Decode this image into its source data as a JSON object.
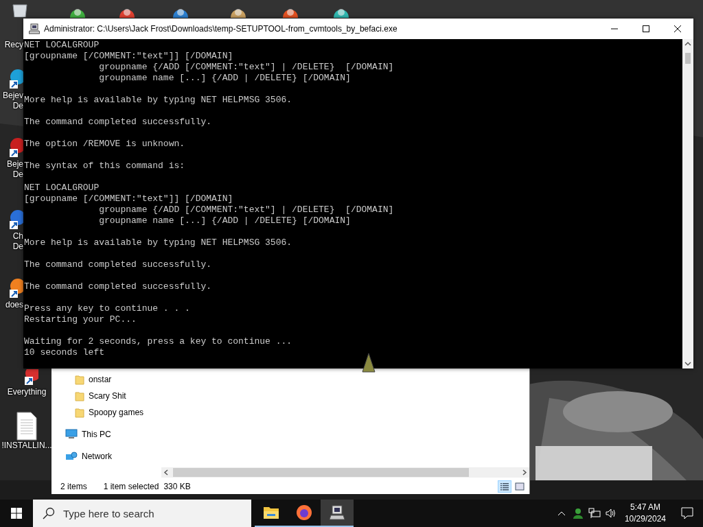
{
  "desktop_icons": [
    {
      "kind": "recycle-bin",
      "lines": [
        "Recy"
      ]
    },
    {
      "kind": "shortcut",
      "lines": [
        "Bejev",
        "De"
      ]
    },
    {
      "kind": "shortcut",
      "lines": [
        "Beje",
        "De"
      ]
    },
    {
      "kind": "shortcut",
      "lines": [
        "Ch",
        "De"
      ]
    },
    {
      "kind": "shortcut",
      "lines": [
        "does"
      ]
    },
    {
      "kind": "shortcut",
      "lines": [
        "Everything"
      ]
    },
    {
      "kind": "document",
      "lines": [
        "!INSTALLIN..."
      ]
    }
  ],
  "console": {
    "title": "Administrator: C:\\Users\\Jack Frost\\Downloads\\temp-SETUPTOOL-from_cvmtools_by_befaci.exe",
    "blocks": [
      [
        "NET LOCALGROUP",
        "[groupname [/COMMENT:\"text\"]] [/DOMAIN]",
        "              groupname {/ADD [/COMMENT:\"text\"] | /DELETE}  [/DOMAIN]",
        "              groupname name [...] {/ADD | /DELETE} [/DOMAIN]"
      ],
      [
        "More help is available by typing NET HELPMSG 3506."
      ],
      [
        "The command completed successfully."
      ],
      [
        "The option /REMOVE is unknown."
      ],
      [
        "The syntax of this command is:"
      ],
      [
        "NET LOCALGROUP",
        "[groupname [/COMMENT:\"text\"]] [/DOMAIN]",
        "              groupname {/ADD [/COMMENT:\"text\"] | /DELETE}  [/DOMAIN]",
        "              groupname name [...] {/ADD | /DELETE} [/DOMAIN]"
      ],
      [
        "More help is available by typing NET HELPMSG 3506."
      ],
      [
        "The command completed successfully."
      ],
      [
        "The command completed successfully."
      ],
      [
        "Press any key to continue . . .",
        "Restarting your PC..."
      ],
      [
        "Waiting for 2 seconds, press a key to continue ...",
        "10 seconds left"
      ]
    ]
  },
  "explorer": {
    "nav_items": [
      {
        "kind": "folder",
        "label": "onstar"
      },
      {
        "kind": "folder",
        "label": "Scary Shit"
      },
      {
        "kind": "folder",
        "label": "Spoopy games"
      },
      {
        "kind": "pc",
        "label": "This PC"
      },
      {
        "kind": "network",
        "label": "Network"
      }
    ],
    "status": {
      "count": "2 items",
      "selection": "1 item selected",
      "size": "330 KB"
    },
    "views": [
      {
        "kind": "details",
        "selected": true
      },
      {
        "kind": "large-icons",
        "selected": false
      }
    ]
  },
  "taskbar": {
    "search": {
      "placeholder": "Type here to search"
    },
    "apps": [
      {
        "kind": "file-explorer",
        "selected": false
      },
      {
        "kind": "firefox",
        "selected": false
      },
      {
        "kind": "console",
        "selected": true
      }
    ],
    "clock": {
      "time": "5:47 AM",
      "date": "10/29/2024"
    }
  }
}
